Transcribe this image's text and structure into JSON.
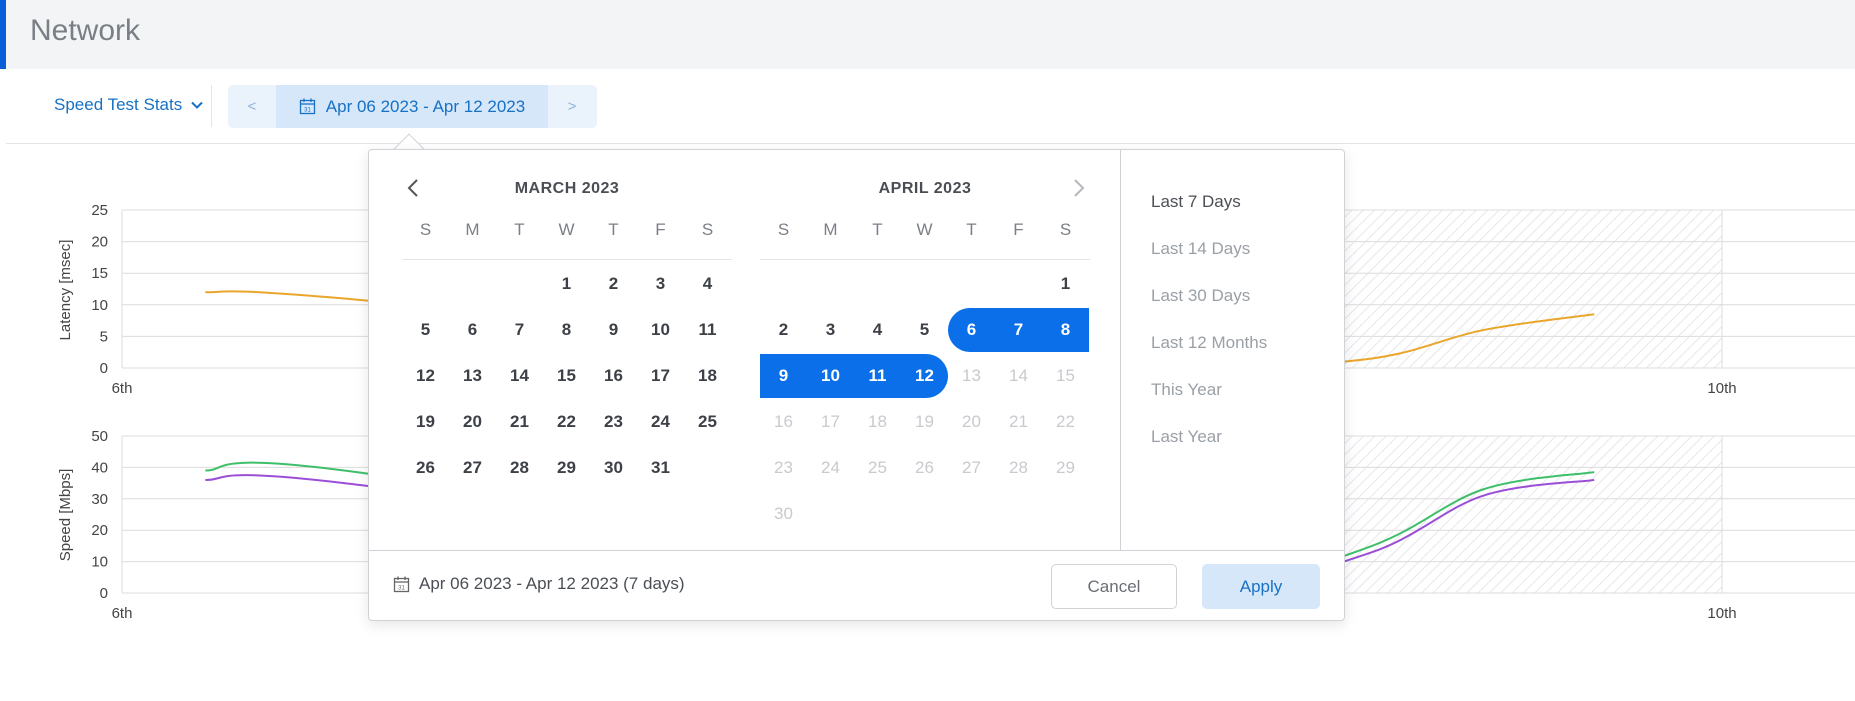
{
  "page": {
    "title": "Network"
  },
  "toolbar": {
    "stat_select_label": "Speed Test Stats",
    "prev_label": "<",
    "next_label": ">",
    "range_label": "Apr 06 2023 - Apr 12 2023"
  },
  "charts": {
    "latency": {
      "ylabel": "Latency [msec]",
      "yticks": [
        "25",
        "20",
        "15",
        "10",
        "5",
        "0"
      ],
      "xticks": [
        "6th",
        "10th"
      ]
    },
    "speed": {
      "ylabel": "Speed [Mbps]",
      "yticks": [
        "50",
        "40",
        "30",
        "20",
        "10",
        "0"
      ],
      "xticks": [
        "6th",
        "10th"
      ]
    }
  },
  "chart_data": [
    {
      "type": "line",
      "ylabel": "Latency [msec]",
      "ylim": [
        0,
        25
      ],
      "x_ticks": [
        "6th",
        "10th"
      ],
      "series": [
        {
          "color": "#e9a62a",
          "points": [
            [
              0.3,
              12
            ],
            [
              0.8,
              11
            ],
            [
              3.3,
              0.9
            ],
            [
              3.9,
              0.1
            ],
            [
              4.5,
              1.5
            ],
            [
              4.9,
              6
            ],
            [
              5.3,
              8.5
            ]
          ]
        }
      ]
    },
    {
      "type": "line",
      "ylabel": "Speed [Mbps]",
      "ylim": [
        0,
        50
      ],
      "x_ticks": [
        "6th",
        "10th"
      ],
      "series": [
        {
          "color": "#3fbf6a",
          "points": [
            [
              0.3,
              39
            ],
            [
              0.8,
              39
            ],
            [
              3.3,
              5
            ],
            [
              3.9,
              0.5
            ],
            [
              4.5,
              15
            ],
            [
              4.9,
              33
            ],
            [
              5.3,
              38.5
            ]
          ]
        },
        {
          "color": "#9a4fd6",
          "points": [
            [
              0.3,
              36
            ],
            [
              0.8,
              35
            ],
            [
              3.3,
              5
            ],
            [
              3.9,
              0.5
            ],
            [
              4.5,
              13
            ],
            [
              4.9,
              31
            ],
            [
              5.3,
              36
            ]
          ]
        }
      ]
    }
  ],
  "datepicker": {
    "months": [
      {
        "title": "MARCH  2023"
      },
      {
        "title": "APRIL  2023"
      }
    ],
    "dow": [
      "S",
      "M",
      "T",
      "W",
      "T",
      "F",
      "S"
    ],
    "march_days": [
      "1",
      "2",
      "3",
      "4",
      "5",
      "6",
      "7",
      "8",
      "9",
      "10",
      "11",
      "12",
      "13",
      "14",
      "15",
      "16",
      "17",
      "18",
      "19",
      "20",
      "21",
      "22",
      "23",
      "24",
      "25",
      "26",
      "27",
      "28",
      "29",
      "30",
      "31"
    ],
    "april_days": [
      "1",
      "2",
      "3",
      "4",
      "5",
      "6",
      "7",
      "8",
      "9",
      "10",
      "11",
      "12",
      "13",
      "14",
      "15",
      "16",
      "17",
      "18",
      "19",
      "20",
      "21",
      "22",
      "23",
      "24",
      "25",
      "26",
      "27",
      "28",
      "29",
      "30"
    ],
    "selected_range": "Apr 6 - Apr 12",
    "presets": [
      "Last 7 Days",
      "Last 14 Days",
      "Last 30 Days",
      "Last 12 Months",
      "This Year",
      "Last Year"
    ],
    "active_preset": "Last 7 Days",
    "footer_range": "Apr 06 2023 - Apr 12 2023 (7 days)",
    "cancel_label": "Cancel",
    "apply_label": "Apply"
  },
  "colors": {
    "accent": "#0a5fd8",
    "selected": "#0a6fe8",
    "link": "#1771c4"
  }
}
